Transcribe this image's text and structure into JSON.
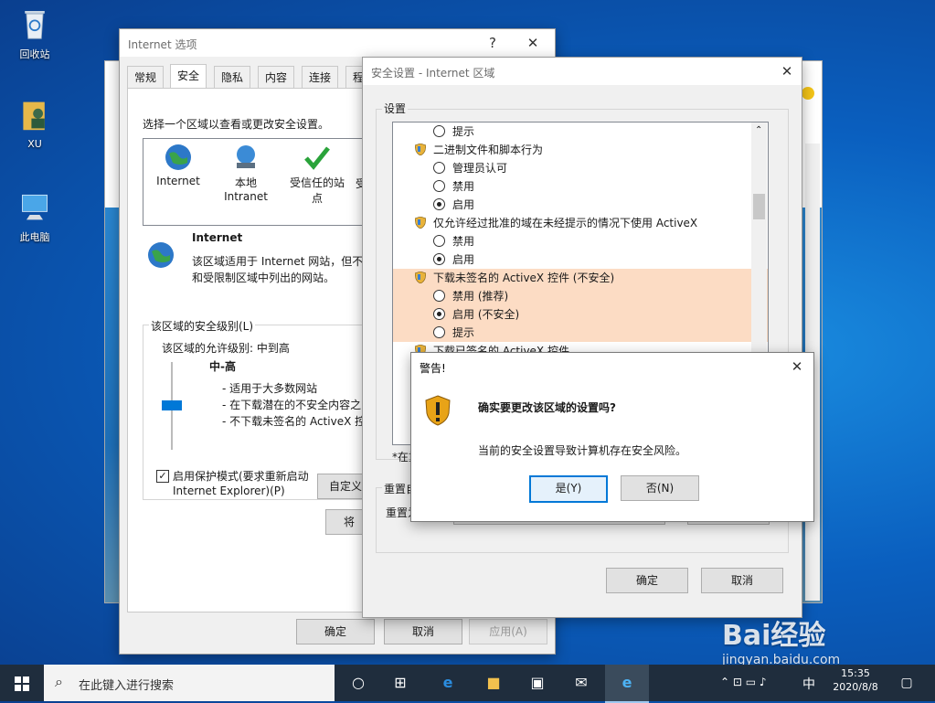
{
  "desktop": {
    "icons": [
      {
        "label": "回收站"
      },
      {
        "label": "XU"
      },
      {
        "label": "此电脑"
      }
    ]
  },
  "internet_options": {
    "title": "Internet 选项",
    "help": "?",
    "close": "✕",
    "tabs": [
      "常规",
      "安全",
      "隐私",
      "内容",
      "连接",
      "程"
    ],
    "active_tab": "安全",
    "instruction": "选择一个区域以查看或更改安全设置。",
    "zones": [
      {
        "label": "Internet"
      },
      {
        "label": "本地\nIntranet"
      },
      {
        "label": "受信任的站\n点"
      },
      {
        "label": "受"
      }
    ],
    "zone_title": "Internet",
    "zone_desc_1": "该区域适用于 Internet 网站，但不",
    "zone_desc_2": "和受限制区域中列出的网站。",
    "level_group": "该区域的安全级别(L)",
    "allowed_level": "该区域的允许级别: 中到高",
    "level_name": "中-高",
    "level_lines": [
      "- 适用于大多数网站",
      "- 在下载潜在的不安全内容之",
      "- 不下载未签名的 ActiveX 控"
    ],
    "protected_mode_1": "启用保护模式(要求重新启动",
    "protected_mode_2": "Internet Explorer)(P)",
    "custom_btn": "自定义",
    "default_btn": "将",
    "ok": "确定",
    "cancel": "取消",
    "apply": "应用(A)"
  },
  "security_settings": {
    "title": "安全设置 - Internet 区域",
    "close": "✕",
    "settings_label": "设置",
    "rows": [
      {
        "kind": "radio",
        "label": "提示",
        "on": false
      },
      {
        "kind": "head",
        "label": "二进制文件和脚本行为"
      },
      {
        "kind": "radio",
        "label": "管理员认可",
        "on": false
      },
      {
        "kind": "radio",
        "label": "禁用",
        "on": false
      },
      {
        "kind": "radio",
        "label": "启用",
        "on": true
      },
      {
        "kind": "head",
        "label": "仅允许经过批准的域在未经提示的情况下使用 ActiveX"
      },
      {
        "kind": "radio",
        "label": "禁用",
        "on": false
      },
      {
        "kind": "radio",
        "label": "启用",
        "on": true
      },
      {
        "kind": "head",
        "label": "下载未签名的 ActiveX 控件 (不安全)",
        "highlight": true
      },
      {
        "kind": "radio",
        "label": "禁用 (推荐)",
        "on": false,
        "highlight": true
      },
      {
        "kind": "radio",
        "label": "启用 (不安全)",
        "on": true,
        "highlight": true
      },
      {
        "kind": "radio",
        "label": "提示",
        "on": false,
        "highlight": true
      },
      {
        "kind": "head",
        "label": "下载已签名的 ActiveX 控件"
      }
    ],
    "note": "*在重",
    "reset_group": "重置自",
    "reset_label": "重置为",
    "ok": "确定",
    "cancel": "取消"
  },
  "warning": {
    "title": "警告!",
    "close": "✕",
    "question": "确实要更改该区域的设置吗?",
    "detail": "当前的安全设置导致计算机存在安全风险。",
    "yes": "是(Y)",
    "no": "否(N)"
  },
  "taskbar": {
    "search_placeholder": "在此键入进行搜索",
    "ime": "中",
    "time": "15:35",
    "date": "2020/8/8"
  },
  "watermark": {
    "text": "Bai经验",
    "url": "jingyan.baidu.com"
  },
  "colors": {
    "highlight": "#fcdcc4",
    "accent": "#0078d7"
  }
}
